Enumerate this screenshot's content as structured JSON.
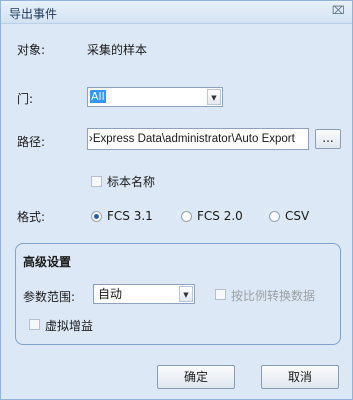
{
  "window": {
    "title": "导出事件",
    "close_glyph": "⌧"
  },
  "object": {
    "label": "对象:",
    "value": "采集的样本"
  },
  "gate": {
    "label": "门:",
    "selected": "All"
  },
  "path": {
    "label": "路径:",
    "value": "›Express Data\\administrator\\Auto Export",
    "browse_label": "..."
  },
  "specimen_name": {
    "label": "标本名称",
    "checked": false
  },
  "format": {
    "label": "格式:",
    "options": [
      {
        "label": "FCS 3.1",
        "checked": true
      },
      {
        "label": "FCS 2.0",
        "checked": false
      },
      {
        "label": "CSV",
        "checked": false
      }
    ]
  },
  "advanced": {
    "title": "高级设置",
    "param_range": {
      "label": "参数范围:",
      "selected": "自动"
    },
    "scale_convert": {
      "label": "按比例转换数据",
      "checked": false
    },
    "virtual_gain": {
      "label": "虚拟增益",
      "checked": false
    }
  },
  "buttons": {
    "ok": "确定",
    "cancel": "取消"
  },
  "icons": {
    "dropdown": "chevron-down-icon",
    "close": "close-icon"
  }
}
